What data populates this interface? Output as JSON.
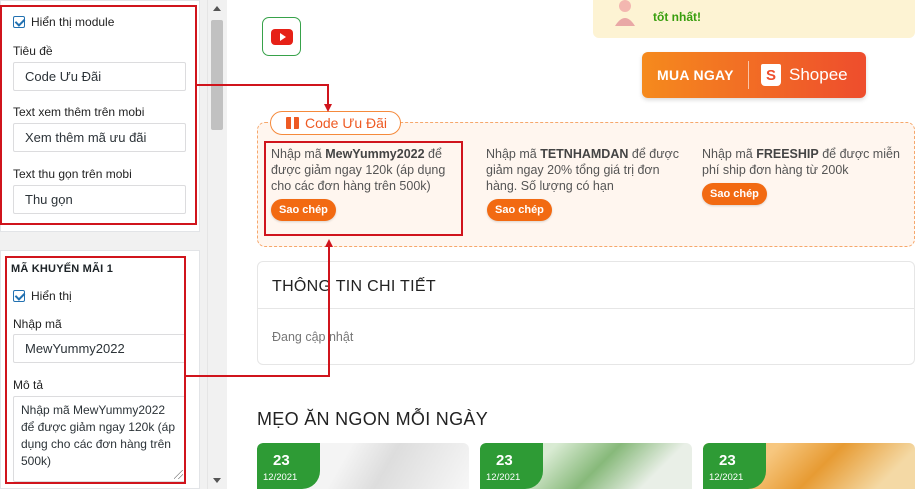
{
  "settings": {
    "card1": {
      "show_module_label": "Hiển thị module",
      "title_label": "Tiêu đề",
      "title_value": "Code Ưu Đãi",
      "more_text_label": "Text xem thêm trên mobi",
      "more_text_value": "Xem thêm mã ưu đãi",
      "collapse_text_label": "Text thu gọn trên mobi",
      "collapse_text_value": "Thu gọn"
    },
    "card2": {
      "heading": "MÃ KHUYẾN MÃI 1",
      "show_label": "Hiển thị",
      "code_label": "Nhập mã",
      "code_value": "MewYummy2022",
      "desc_label": "Mô tả",
      "desc_value": "Nhập mã MewYummy2022 để được giảm ngay 120k (áp dụng cho các đơn hàng trên 500k)"
    }
  },
  "hotline": {
    "text": "tốt nhất!"
  },
  "shopee": {
    "buy_label": "MUA NGAY",
    "brand": "Shopee",
    "bag_letter": "S"
  },
  "coupons": {
    "tag_label": "Code Ưu Đãi",
    "items": [
      {
        "prefix": "Nhập mã ",
        "code": "MewYummy2022",
        "suffix": " để được giảm ngay 120k (áp dụng cho các đơn hàng trên 500k)",
        "button": "Sao chép"
      },
      {
        "prefix": "Nhập mã ",
        "code": "TETNHAMDAN",
        "suffix": " để được giảm ngay 20% tổng giá trị đơn hàng. Số lượng có hạn",
        "button": "Sao chép"
      },
      {
        "prefix": "Nhập mã ",
        "code": "FREESHIP",
        "suffix": " để được miễn phí ship đơn hàng từ 200k",
        "button": "Sao chép"
      }
    ]
  },
  "detail": {
    "title": "THÔNG TIN CHI TIẾT",
    "status": "Đang cập nhật"
  },
  "tips": {
    "title": "MẸO ĂN NGON MỖI NGÀY",
    "items": [
      {
        "day": "23",
        "month_year": "12/2021"
      },
      {
        "day": "23",
        "month_year": "12/2021"
      },
      {
        "day": "23",
        "month_year": "12/2021"
      }
    ]
  },
  "colors": {
    "accent_orange": "#f26a12",
    "brand_green": "#2e9b35",
    "annotation_red": "#d0141c"
  },
  "icons": [
    "checkbox-icon",
    "youtube-icon",
    "shopee-bag-icon",
    "gift-icon",
    "resize-handle-icon"
  ]
}
